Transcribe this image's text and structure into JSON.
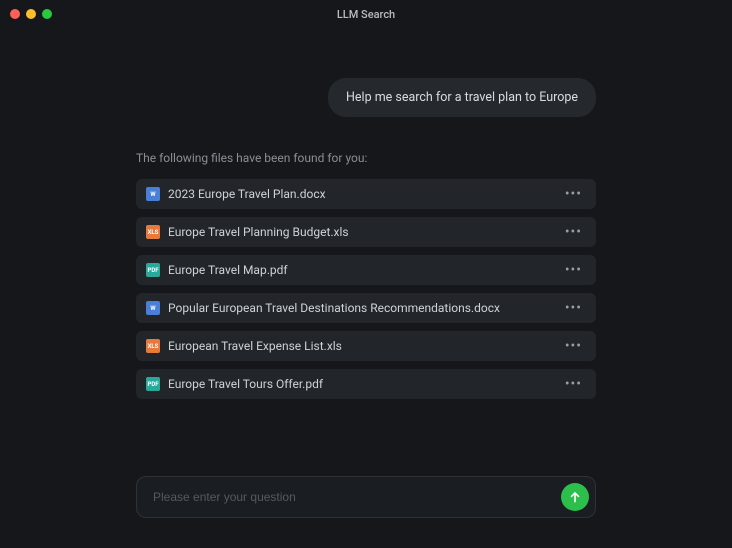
{
  "window": {
    "title": "LLM Search"
  },
  "chat": {
    "user_message": "Help me search for a travel plan to Europe",
    "assistant_intro": "The following files have been found for you:"
  },
  "files": [
    {
      "name": "2023 Europe Travel Plan.docx",
      "type": "docx",
      "icon_label": "W"
    },
    {
      "name": "Europe Travel Planning Budget.xls",
      "type": "xls",
      "icon_label": "XLS"
    },
    {
      "name": "Europe Travel Map.pdf",
      "type": "pdf",
      "icon_label": "PDF"
    },
    {
      "name": "Popular European Travel Destinations Recommendations.docx",
      "type": "docx",
      "icon_label": "W"
    },
    {
      "name": "European Travel Expense List.xls",
      "type": "xls",
      "icon_label": "XLS"
    },
    {
      "name": "Europe Travel Tours Offer.pdf",
      "type": "pdf",
      "icon_label": "PDF"
    }
  ],
  "input": {
    "placeholder": "Please enter your question",
    "value": ""
  },
  "colors": {
    "accent_send": "#2cbf4c",
    "docx": "#4a7fd8",
    "xls": "#e67a3c",
    "pdf": "#2aa99b"
  }
}
